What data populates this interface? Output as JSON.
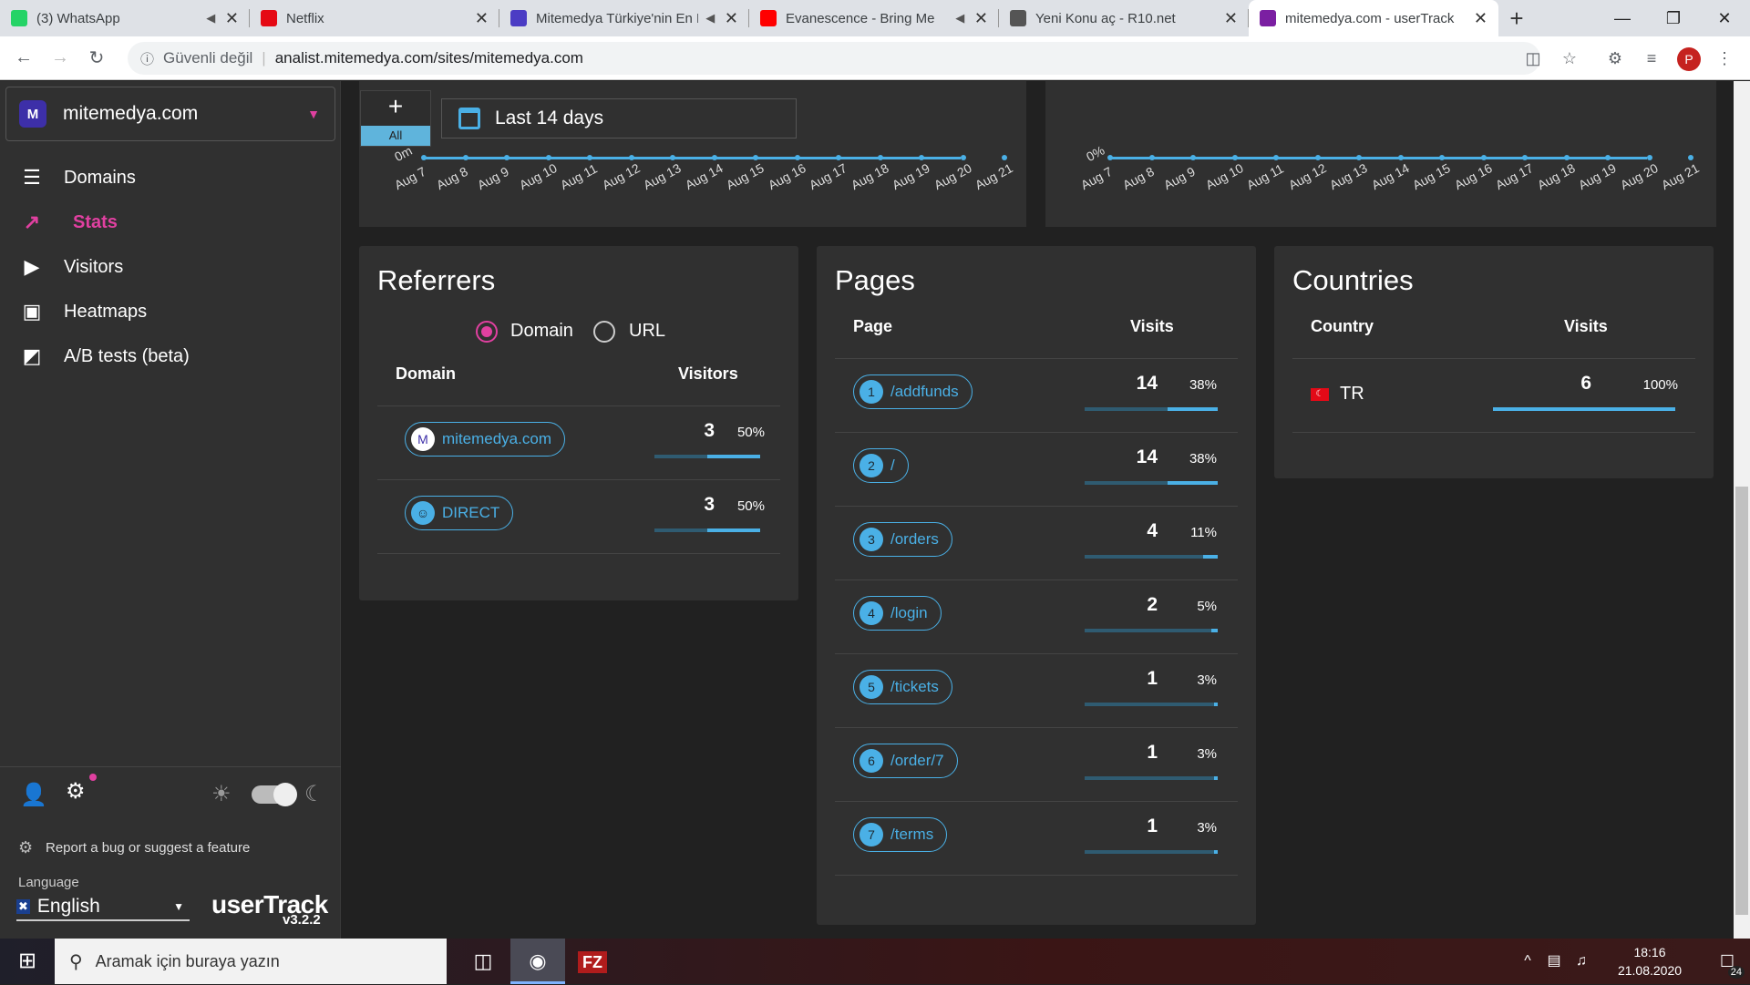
{
  "browser": {
    "tabs": [
      {
        "title": "(3) WhatsApp",
        "icon": "whatsapp-icon",
        "muted": true
      },
      {
        "title": "Netflix",
        "icon": "netflix-icon",
        "muted": false
      },
      {
        "title": "Mitemedya Türkiye'nin En Bü",
        "icon": "mitemedya-icon",
        "muted": true
      },
      {
        "title": "Evanescence - Bring Me",
        "icon": "youtube-icon",
        "muted": true
      },
      {
        "title": "Yeni Konu aç - R10.net",
        "icon": "r10-icon",
        "muted": false
      },
      {
        "title": "mitemedya.com - userTrack",
        "icon": "usertrack-icon",
        "muted": false,
        "active": true
      }
    ],
    "security": "Güvenli değil",
    "url": "analist.mitemedya.com/sites/mitemedya.com",
    "profile_initial": "P"
  },
  "sidebar": {
    "domain": "mitemedya.com",
    "nav": [
      {
        "label": "Domains",
        "icon": "list-icon"
      },
      {
        "label": "Stats",
        "icon": "stats-icon",
        "active": true
      },
      {
        "label": "Visitors",
        "icon": "play-icon"
      },
      {
        "label": "Heatmaps",
        "icon": "heatmap-icon"
      },
      {
        "label": "A/B tests (beta)",
        "icon": "ab-test-icon"
      }
    ],
    "report": "Report a bug or suggest a feature",
    "language_label": "Language",
    "language": "English",
    "brand": "userTrack",
    "version": "v3.2.2"
  },
  "toolbar": {
    "add_label": "All",
    "date_range": "Last 14 days"
  },
  "charts": {
    "left_top_tick": "0m",
    "right_top_tick": "0%",
    "ticks": [
      "Aug 7",
      "Aug 8",
      "Aug 9",
      "Aug 10",
      "Aug 11",
      "Aug 12",
      "Aug 13",
      "Aug 14",
      "Aug 15",
      "Aug 16",
      "Aug 17",
      "Aug 18",
      "Aug 19",
      "Aug 20",
      "Aug 21"
    ]
  },
  "referrers": {
    "title": "Referrers",
    "options": [
      "Domain",
      "URL"
    ],
    "selected": "Domain",
    "headers": [
      "Domain",
      "Visitors"
    ],
    "rows": [
      {
        "label": "mitemedya.com",
        "icon": "mitemedya-icon",
        "value": "3",
        "pct": "50%",
        "fraction": 0.5
      },
      {
        "label": "DIRECT",
        "icon": "user-icon",
        "value": "3",
        "pct": "50%",
        "fraction": 0.5
      }
    ]
  },
  "pages": {
    "title": "Pages",
    "headers": [
      "Page",
      "Visits"
    ],
    "rows": [
      {
        "n": "1",
        "label": "/addfunds",
        "value": "14",
        "pct": "38%",
        "fraction": 0.38
      },
      {
        "n": "2",
        "label": "/",
        "value": "14",
        "pct": "38%",
        "fraction": 0.38
      },
      {
        "n": "3",
        "label": "/orders",
        "value": "4",
        "pct": "11%",
        "fraction": 0.11
      },
      {
        "n": "4",
        "label": "/login",
        "value": "2",
        "pct": "5%",
        "fraction": 0.05
      },
      {
        "n": "5",
        "label": "/tickets",
        "value": "1",
        "pct": "3%",
        "fraction": 0.03
      },
      {
        "n": "6",
        "label": "/order/7",
        "value": "1",
        "pct": "3%",
        "fraction": 0.03
      },
      {
        "n": "7",
        "label": "/terms",
        "value": "1",
        "pct": "3%",
        "fraction": 0.03
      }
    ]
  },
  "countries": {
    "title": "Countries",
    "headers": [
      "Country",
      "Visits"
    ],
    "rows": [
      {
        "label": "TR",
        "icon": "turkey-flag-icon",
        "value": "6",
        "pct": "100%",
        "fraction": 1.0
      }
    ]
  },
  "taskbar": {
    "search_placeholder": "Aramak için buraya yazın",
    "time": "18:16",
    "date": "21.08.2020",
    "notifications": "24"
  },
  "colors": {
    "accent": "#e040a0",
    "bar": "#4ab0e6"
  }
}
